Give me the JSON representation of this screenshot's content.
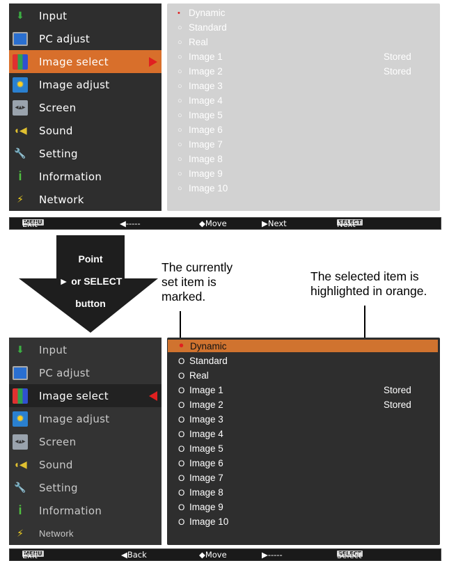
{
  "menu": {
    "items": [
      {
        "label": "Input",
        "icon": "input-icon"
      },
      {
        "label": "PC adjust",
        "icon": "pc-adjust-icon"
      },
      {
        "label": "Image select",
        "icon": "image-select-icon"
      },
      {
        "label": "Image adjust",
        "icon": "image-adjust-icon"
      },
      {
        "label": "Screen",
        "icon": "screen-icon"
      },
      {
        "label": "Sound",
        "icon": "sound-icon"
      },
      {
        "label": "Setting",
        "icon": "setting-icon"
      },
      {
        "label": "Information",
        "icon": "information-icon"
      },
      {
        "label": "Network",
        "icon": "network-icon"
      }
    ]
  },
  "submenu": {
    "items": [
      {
        "label": "Dynamic",
        "stored": ""
      },
      {
        "label": "Standard",
        "stored": ""
      },
      {
        "label": "Real",
        "stored": ""
      },
      {
        "label": "Image 1",
        "stored": "Stored"
      },
      {
        "label": "Image 2",
        "stored": "Stored"
      },
      {
        "label": "Image 3",
        "stored": ""
      },
      {
        "label": "Image 4",
        "stored": ""
      },
      {
        "label": "Image 5",
        "stored": ""
      },
      {
        "label": "Image 6",
        "stored": ""
      },
      {
        "label": "Image 7",
        "stored": ""
      },
      {
        "label": "Image 8",
        "stored": ""
      },
      {
        "label": "Image 9",
        "stored": ""
      },
      {
        "label": "Image 10",
        "stored": ""
      }
    ],
    "mark_current": "•",
    "mark_open_top": "○",
    "mark_open_bottom": "O"
  },
  "statusbar_top": {
    "menu_key": "MENU",
    "exit": "Exit",
    "left": "◀-----",
    "move": "◆Move",
    "next": "▶Next",
    "select_key": "SELECT",
    "select": "Next"
  },
  "statusbar_bottom": {
    "menu_key": "MENU",
    "exit": "Exit",
    "back": "◀Back",
    "move": "◆Move",
    "next": "▶-----",
    "select_key": "SELECT",
    "select": "Select"
  },
  "instruction": {
    "line1": "Point",
    "line2": "► or SELECT",
    "line3": "button"
  },
  "callouts": {
    "current_l1": "The currently",
    "current_l2": "set item is",
    "current_l3": "marked.",
    "selected_l1": "The selected item is",
    "selected_l2": "highlighted in orange."
  },
  "colors": {
    "accent": "#d86f2b",
    "panel": "#2e2e2e",
    "submenu_light": "#d2d2d2",
    "marker": "#e02020"
  }
}
